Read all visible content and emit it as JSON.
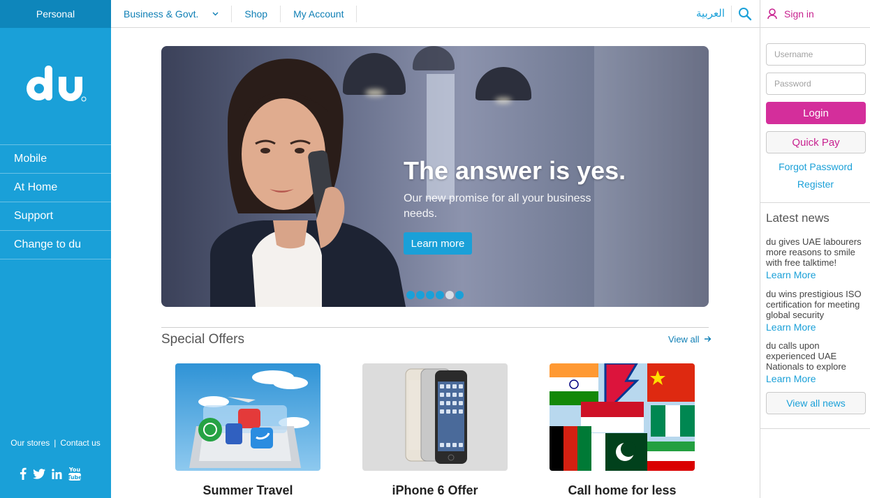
{
  "sidebar": {
    "personal_tab": "Personal",
    "logo_text": "du",
    "nav": [
      "Mobile",
      "At Home",
      "Support",
      "Change to du"
    ],
    "our_stores": "Our stores",
    "separator": "|",
    "contact_us": "Contact us",
    "social": [
      "facebook-icon",
      "twitter-icon",
      "linkedin-icon",
      "youtube-icon"
    ]
  },
  "topnav": {
    "business": "Business & Govt.",
    "shop": "Shop",
    "my_account": "My Account",
    "arabic": "العربية"
  },
  "account": {
    "sign_in": "Sign in",
    "username_placeholder": "Username",
    "password_placeholder": "Password",
    "login": "Login",
    "quick_pay": "Quick Pay",
    "forgot_password": "Forgot Password",
    "register": "Register"
  },
  "news": {
    "title": "Latest news",
    "items": [
      {
        "text": "du gives UAE labourers more reasons to smile with free talktime!",
        "more": "Learn More"
      },
      {
        "text": "du wins prestigious ISO certification for meeting global security",
        "more": "Learn More"
      },
      {
        "text": "du calls upon experienced UAE Nationals to explore",
        "more": "Learn More"
      }
    ],
    "view_all": "View all news"
  },
  "hero": {
    "headline": "The answer is yes.",
    "subtext": "Our new promise for all your business needs.",
    "cta": "Learn more",
    "slides": 6,
    "active_slide": 5
  },
  "offers": {
    "title": "Special Offers",
    "view_all": "View all",
    "cards": [
      "Summer Travel",
      "iPhone 6 Offer",
      "Call home for less"
    ]
  },
  "colors": {
    "brand_blue": "#1aa0d8",
    "brand_magenta": "#d42e9b",
    "link_blue": "#0f7fb5"
  }
}
